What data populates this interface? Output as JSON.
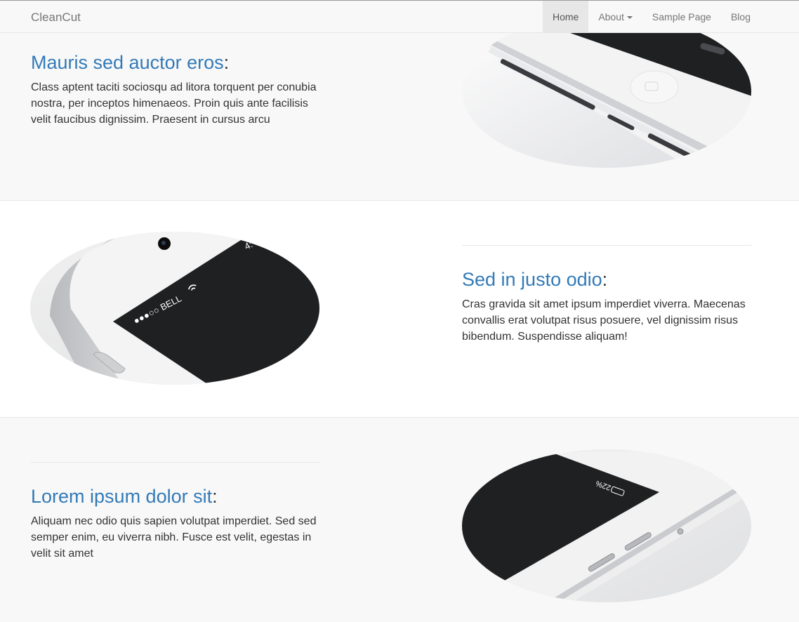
{
  "navbar": {
    "brand": "CleanCut",
    "items": [
      {
        "label": "Home"
      },
      {
        "label": "About"
      },
      {
        "label": "Sample Page"
      },
      {
        "label": "Blog"
      }
    ]
  },
  "sections": [
    {
      "heading": "Mauris sed auctor eros",
      "text": "Class aptent taciti sociosqu ad litora torquent per conubia nostra, per inceptos himenaeos. Proin quis ante facilisis velit faucibus dignissim. Praesent in cursus arcu"
    },
    {
      "heading": "Sed in justo odio",
      "text": "Cras gravida sit amet ipsum imperdiet viverra. Maecenas convallis erat volutpat risus posuere, vel dignissim risus bibendum. Suspendisse aliquam!",
      "phone_carrier": "●●●○○ BELL",
      "phone_time": "4:"
    },
    {
      "heading": "Lorem ipsum dolor sit",
      "text": "Aliquam nec odio quis sapien volutpat imperdiet. Sed sed semper enim, eu viverra nibh. Fusce est velit, egestas in velit sit amet",
      "battery_text": "22%"
    }
  ],
  "heading_suffix": ":"
}
